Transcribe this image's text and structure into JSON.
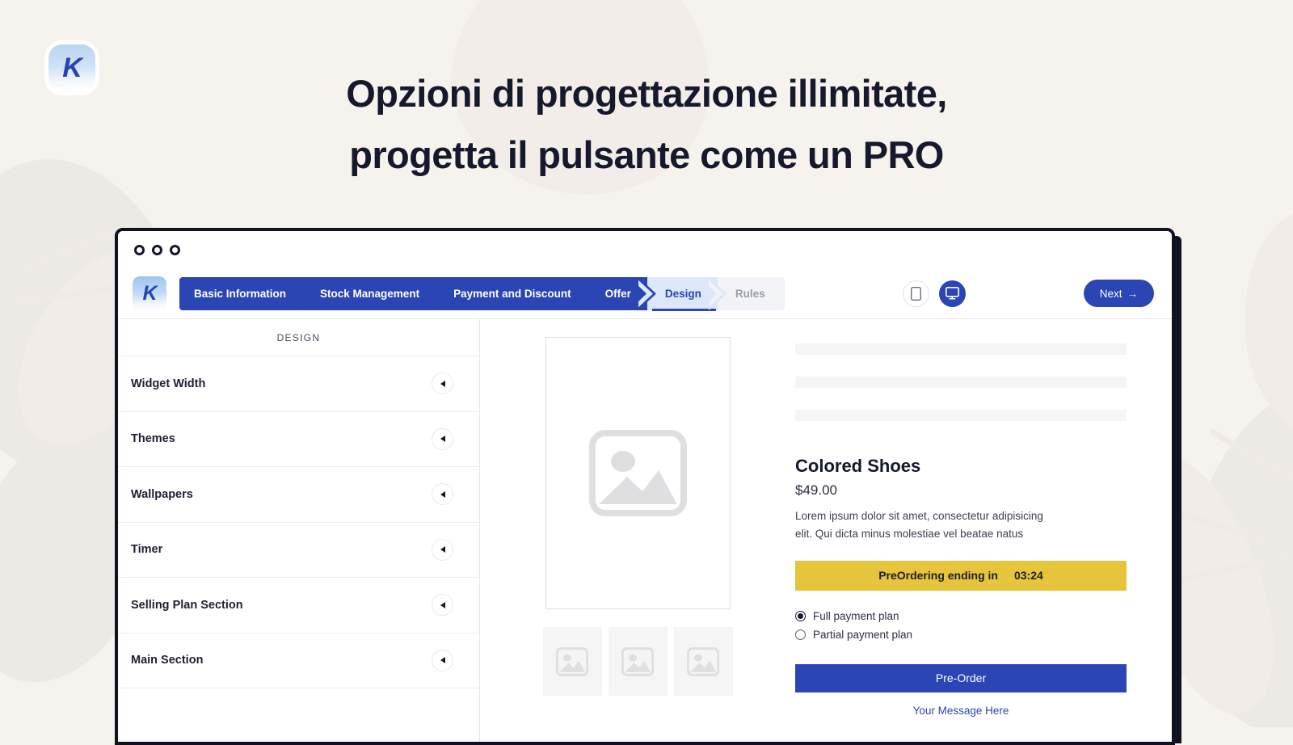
{
  "background_color": "#F6F2EE",
  "brand": {
    "logo_letter": "K",
    "accent": "#2B45B4",
    "accent_light": "#DCE7FA",
    "countdown_color": "#E6C43B"
  },
  "hero": {
    "line1": "Opzioni di progettazione illimitate,",
    "line2": "progetta il pulsante come un PRO"
  },
  "window": {
    "titlebar": {
      "dot_count": 3
    }
  },
  "topbar": {
    "logo_letter": "K",
    "steps": [
      {
        "label": "Basic Information",
        "state": "done"
      },
      {
        "label": "Stock Management",
        "state": "done"
      },
      {
        "label": "Payment and Discount",
        "state": "done"
      },
      {
        "label": "Offer",
        "state": "done"
      },
      {
        "label": "Design",
        "state": "active"
      },
      {
        "label": "Rules",
        "state": "todo"
      }
    ],
    "devices": [
      {
        "name": "mobile-view",
        "icon": "phone-icon",
        "active": false
      },
      {
        "name": "desktop-view",
        "icon": "monitor-icon",
        "active": true
      }
    ],
    "next_label": "Next",
    "next_arrow": "→"
  },
  "sidebar": {
    "header": "DESIGN",
    "items": [
      {
        "label": "Widget Width"
      },
      {
        "label": "Themes"
      },
      {
        "label": "Wallpapers"
      },
      {
        "label": "Timer"
      },
      {
        "label": "Selling Plan Section"
      },
      {
        "label": "Main Section"
      }
    ]
  },
  "preview": {
    "gallery": {
      "thumb_count": 3
    },
    "product": {
      "title": "Colored Shoes",
      "price": "$49.00",
      "description": "Lorem ipsum dolor sit amet, consectetur adipisicing elit. Qui dicta minus molestiae vel beatae natus"
    },
    "countdown": {
      "label": "PreOrdering ending in",
      "time": "03:24"
    },
    "plans": [
      {
        "label": "Full payment plan",
        "selected": true
      },
      {
        "label": "Partial payment plan",
        "selected": false
      }
    ],
    "preorder_label": "Pre-Order",
    "message_link": "Your Message Here"
  }
}
